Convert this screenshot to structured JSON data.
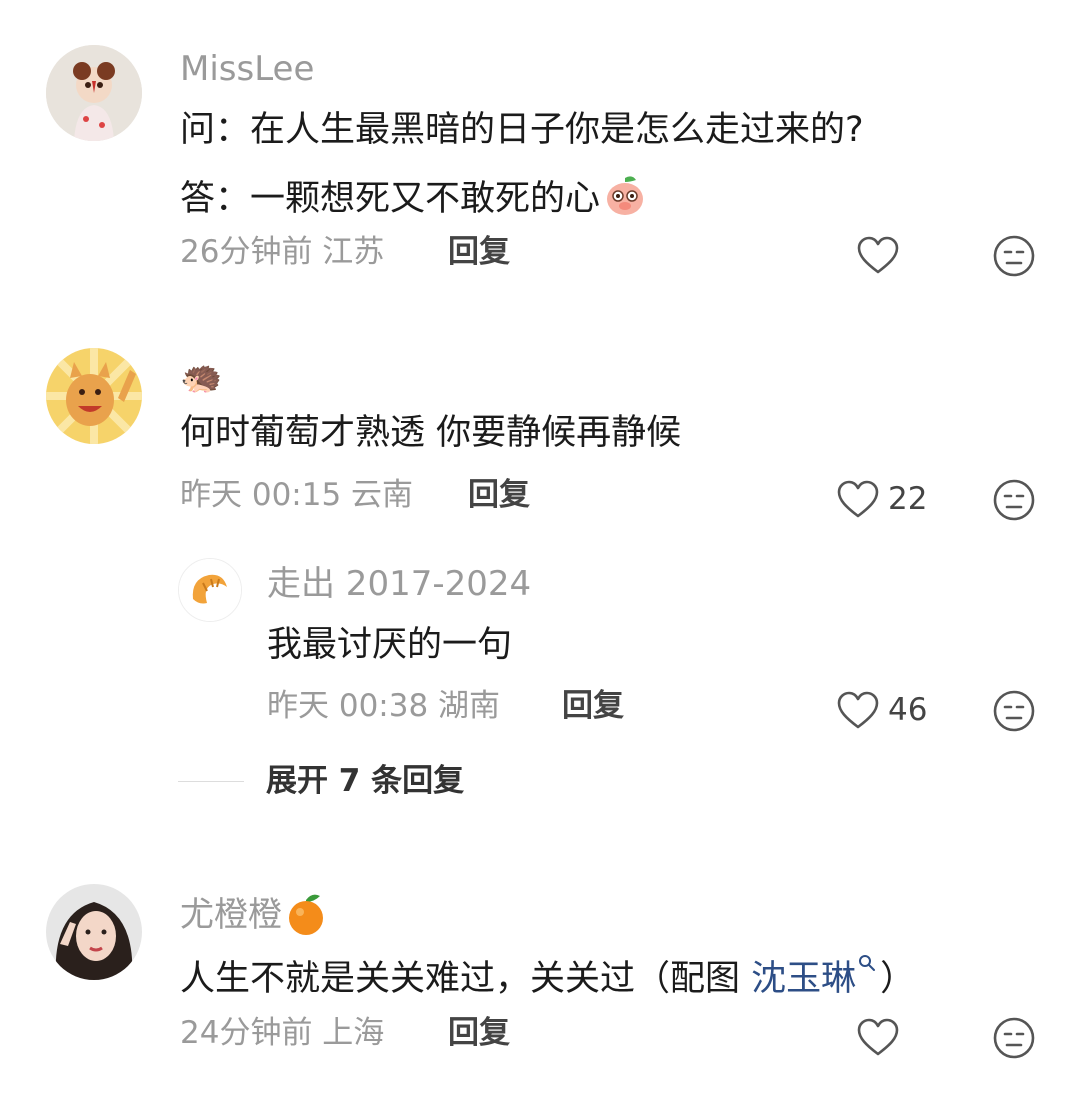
{
  "comments": [
    {
      "username": "MissLee",
      "lines": [
        "问：在人生最黑暗的日子你是怎么走过来的?",
        "答：一颗想死又不敢死的心"
      ],
      "meta": "26分钟前 江苏",
      "reply_label": "回复",
      "likes": ""
    },
    {
      "username": "🦔",
      "lines": [
        "何时葡萄才熟透 你要静候再静候"
      ],
      "meta": "昨天 00:15 云南",
      "reply_label": "回复",
      "likes": "22",
      "replies": [
        {
          "username": "走出 2017-2024",
          "lines": [
            "我最讨厌的一句"
          ],
          "meta": "昨天 00:38 湖南",
          "reply_label": "回复",
          "likes": "46"
        }
      ],
      "expand_label": "展开 7 条回复"
    },
    {
      "username": "尤橙橙",
      "lines": [
        "人生不就是关关难过，关关过（配图 ",
        "沈玉琳",
        "）"
      ],
      "meta": "24分钟前 上海",
      "reply_label": "回复",
      "likes": ""
    }
  ],
  "icons": {
    "like": "heart-outline-icon",
    "dislike": "meh-face-icon",
    "orange": "orange-emoji-icon",
    "peach": "peach-emoji-icon",
    "search": "search-superscript-icon"
  },
  "colors": {
    "text": "#1b1b1b",
    "meta": "#9a9a9a",
    "link": "#2d4e86"
  }
}
